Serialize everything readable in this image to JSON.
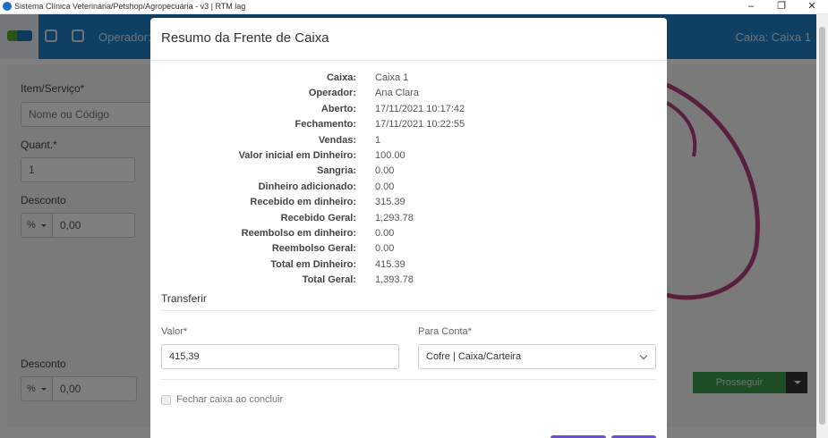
{
  "window": {
    "title": "Sistema Clínica Veterinária/Petshop/Agropecuária - v3 | RTM lag",
    "controls": {
      "minimize": "–",
      "maximize": "❐",
      "close": "✕"
    }
  },
  "nav": {
    "operator_label": "Operador:",
    "caixa_label": "Caixa: Caixa 1"
  },
  "background": {
    "item_label": "Item/Serviço*",
    "item_placeholder": "Nome ou Código",
    "quant_label": "Quant.*",
    "quant_value": "1",
    "desconto_label": "Desconto",
    "desconto_mode": "%",
    "desconto_value": "0,00",
    "desconto2_label": "Desconto",
    "desconto2_mode": "%",
    "desconto2_value": "0,00",
    "prosseguir_label": "Prosseguir"
  },
  "modal": {
    "title": "Resumo da Frente de Caixa",
    "summary": [
      {
        "label": "Caixa:",
        "value": "Caixa 1"
      },
      {
        "label": "Operador:",
        "value": "Ana Clara"
      },
      {
        "label": "Aberto:",
        "value": "17/11/2021 10:17:42"
      },
      {
        "label": "Fechamento:",
        "value": "17/11/2021 10:22:55"
      },
      {
        "label": "Vendas:",
        "value": "1"
      },
      {
        "label": "Valor inicial em Dinheiro:",
        "value": "100.00"
      },
      {
        "label": "Sangria:",
        "value": "0.00"
      },
      {
        "label": "Dinheiro adicionado:",
        "value": "0.00"
      },
      {
        "label": "Recebido em dinheiro:",
        "value": "315.39"
      },
      {
        "label": "Recebido Geral:",
        "value": "1,293.78"
      },
      {
        "label": "Reembolso em dinheiro:",
        "value": "0.00"
      },
      {
        "label": "Reembolso Geral:",
        "value": "0.00"
      },
      {
        "label": "Total em Dinheiro:",
        "value": "415.39"
      },
      {
        "label": "Total Geral:",
        "value": "1,393.78"
      }
    ],
    "transfer_title": "Transferir",
    "valor_label": "Valor*",
    "valor_value": "415,39",
    "conta_label": "Para Conta*",
    "conta_value": "Cofre | Caixa/Carteira",
    "fechar_label": "Fechar caixa ao concluir",
    "fechar_checked": false
  },
  "colors": {
    "nav": "#1f7fc4",
    "accent_button": "#6c4fd3",
    "prosseguir": "#3a9a4a"
  }
}
